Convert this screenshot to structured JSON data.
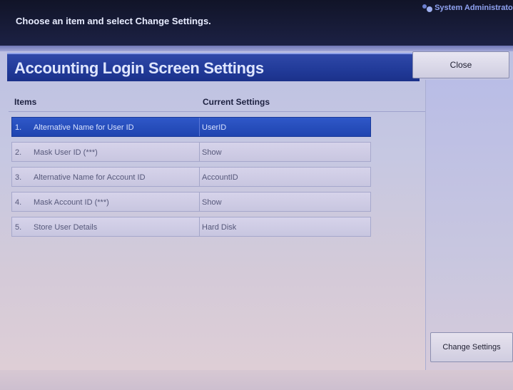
{
  "header": {
    "message": "Choose an item and select Change Settings.",
    "user": "System Administrator"
  },
  "panel": {
    "title": "Accounting Login Screen Settings",
    "close_label": "Close"
  },
  "table": {
    "col_items": "Items",
    "col_settings": "Current Settings",
    "rows": [
      {
        "num": "1.",
        "name": "Alternative Name for User ID",
        "value": "UserID"
      },
      {
        "num": "2.",
        "name": "Mask User ID (***)",
        "value": "Show"
      },
      {
        "num": "3.",
        "name": "Alternative Name for Account ID",
        "value": "AccountID"
      },
      {
        "num": "4.",
        "name": "Mask Account ID (***)",
        "value": "Show"
      },
      {
        "num": "5.",
        "name": "Store User Details",
        "value": "Hard Disk"
      }
    ],
    "selected_index": 0
  },
  "actions": {
    "change_settings_label": "Change Settings"
  },
  "colors": {
    "selected_row": "#2448b8",
    "title_bar": "#213a98",
    "top_bar": "#141830"
  },
  "icons": {
    "user": "user-group-icon"
  }
}
